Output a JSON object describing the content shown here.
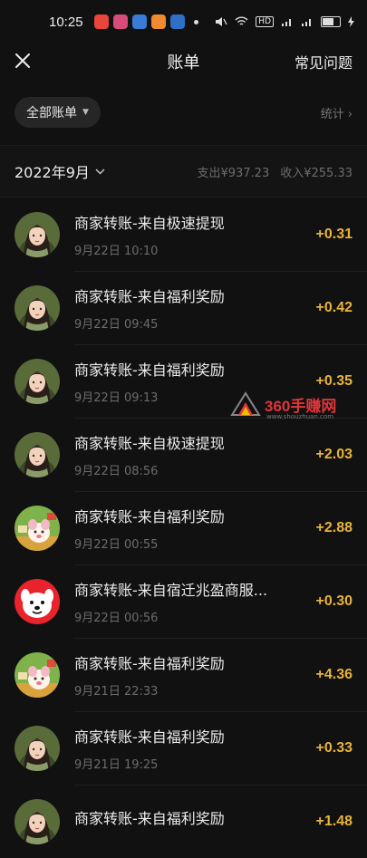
{
  "status_bar": {
    "time": "10:25",
    "app_icon_colors": [
      "#e8453c",
      "#d84b7a",
      "#3a7bd5",
      "#f08a2e",
      "#2f6fc6"
    ],
    "network_text": "HD"
  },
  "header": {
    "title": "账单",
    "faq_label": "常见问题",
    "close_icon": "close-icon"
  },
  "filter": {
    "all_bills_label": "全部账单",
    "stats_label": "统计"
  },
  "month_bar": {
    "month_label": "2022年9月",
    "expense_label": "支出¥937.23",
    "income_label": "收入¥255.33"
  },
  "transactions": [
    {
      "name": "商家转账-来自极速提现",
      "time": "9月22日 10:10",
      "amount": "+0.31",
      "avatar": "lady"
    },
    {
      "name": "商家转账-来自福利奖励",
      "time": "9月22日 09:45",
      "amount": "+0.42",
      "avatar": "lady"
    },
    {
      "name": "商家转账-来自福利奖励",
      "time": "9月22日 09:13",
      "amount": "+0.35",
      "avatar": "lady"
    },
    {
      "name": "商家转账-来自极速提现",
      "time": "9月22日 08:56",
      "amount": "+2.03",
      "avatar": "lady"
    },
    {
      "name": "商家转账-来自福利奖励",
      "time": "9月22日 00:55",
      "amount": "+2.88",
      "avatar": "cartoon"
    },
    {
      "name": "商家转账-来自宿迁兆盈商服...",
      "time": "9月22日 00:56",
      "amount": "+0.30",
      "avatar": "dog"
    },
    {
      "name": "商家转账-来自福利奖励",
      "time": "9月21日 22:33",
      "amount": "+4.36",
      "avatar": "cartoon"
    },
    {
      "name": "商家转账-来自福利奖励",
      "time": "9月21日 19:25",
      "amount": "+0.33",
      "avatar": "lady"
    },
    {
      "name": "商家转账-来自福利奖励",
      "time": "",
      "amount": "+1.48",
      "avatar": "lady"
    }
  ],
  "watermark": {
    "text": "360手赚网",
    "subtext": "www.shouzhuan.com"
  },
  "colors": {
    "accent_amount": "#e8b43c",
    "background": "#111111"
  }
}
